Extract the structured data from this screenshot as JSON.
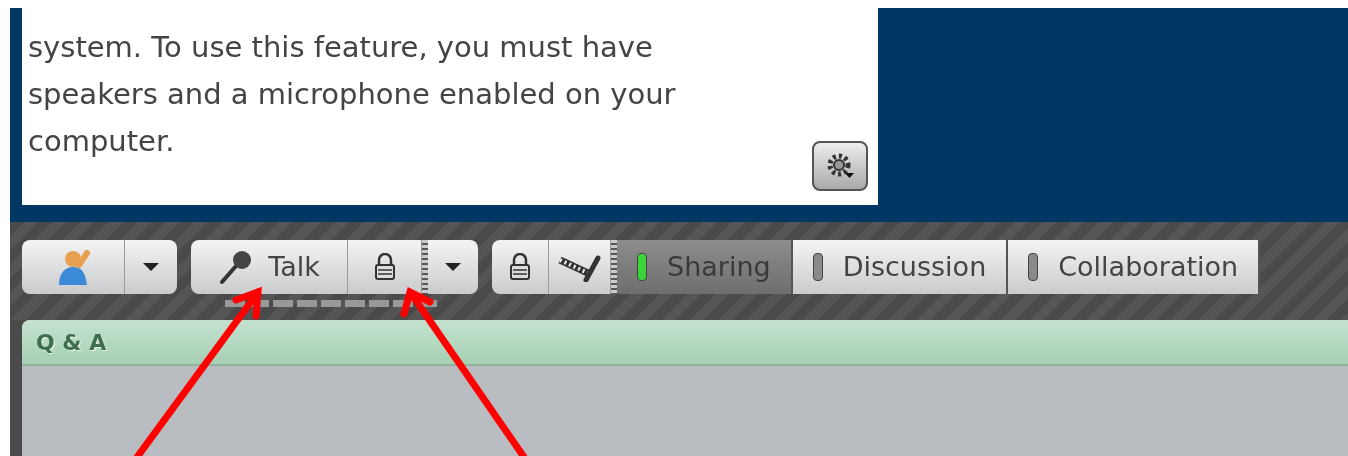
{
  "info_panel": {
    "text": "system. To use this feature, you must have speakers and a microphone enabled on your computer."
  },
  "toolbar": {
    "talk_button": {
      "label": "Talk"
    },
    "modes": [
      {
        "label": "Sharing",
        "selected": true
      },
      {
        "label": "Discussion",
        "selected": false
      },
      {
        "label": "Collaboration",
        "selected": false
      }
    ]
  },
  "qa_panel": {
    "title": "Q & A"
  }
}
